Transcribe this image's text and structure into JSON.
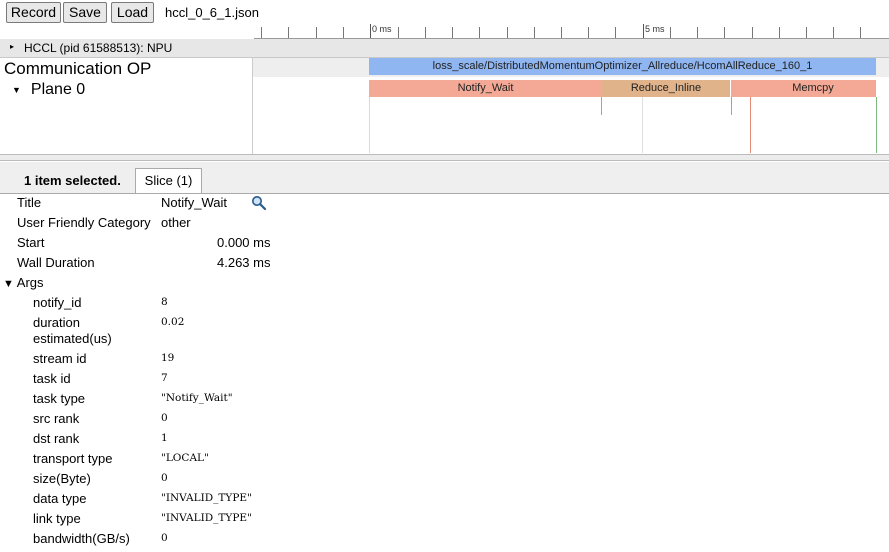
{
  "toolbar": {
    "record_label": "Record",
    "save_label": "Save",
    "load_label": "Load",
    "filename": "hccl_0_6_1.json"
  },
  "ruler": {
    "label_0": "0 ms",
    "label_5": "5 ms"
  },
  "process": {
    "title": "HCCL (pid 61588513): NPU"
  },
  "track": {
    "title": "Communication OP",
    "plane": "Plane 0"
  },
  "slices": {
    "top": "loss_scale/DistributedMomentumOptimizer_Allreduce/HcomAllReduce_160_1",
    "notify": "Notify_Wait",
    "reduce": "Reduce_Inline",
    "memcpy": "Memcpy"
  },
  "details": {
    "selected_label": "1 item selected.",
    "tab_label": "Slice (1)",
    "title_key": "Title",
    "title_val": "Notify_Wait",
    "category_key": "User Friendly Category",
    "category_val": "other",
    "start_key": "Start",
    "start_val": "0.000 ms",
    "duration_key": "Wall Duration",
    "duration_val": "4.263 ms",
    "args_label": "Args",
    "args": [
      {
        "key": "notify_id",
        "val": "8"
      },
      {
        "key": "duration estimated(us)",
        "val": "0.02"
      },
      {
        "key": "stream id",
        "val": "19"
      },
      {
        "key": "task id",
        "val": "7"
      },
      {
        "key": "task type",
        "val": "\"Notify_Wait\""
      },
      {
        "key": "src rank",
        "val": "0"
      },
      {
        "key": "dst rank",
        "val": "1"
      },
      {
        "key": "transport type",
        "val": "\"LOCAL\""
      },
      {
        "key": "size(Byte)",
        "val": "0"
      },
      {
        "key": "data type",
        "val": "\"INVALID_TYPE\""
      },
      {
        "key": "link type",
        "val": "\"INVALID_TYPE\""
      },
      {
        "key": "bandwidth(GB/s)",
        "val": "0"
      }
    ]
  },
  "colors": {
    "top_slice": "#8fb6f1",
    "notify_slice": "#f4a996",
    "reduce_slice": "#e0b38a",
    "memcpy_slice": "#f4a996"
  }
}
